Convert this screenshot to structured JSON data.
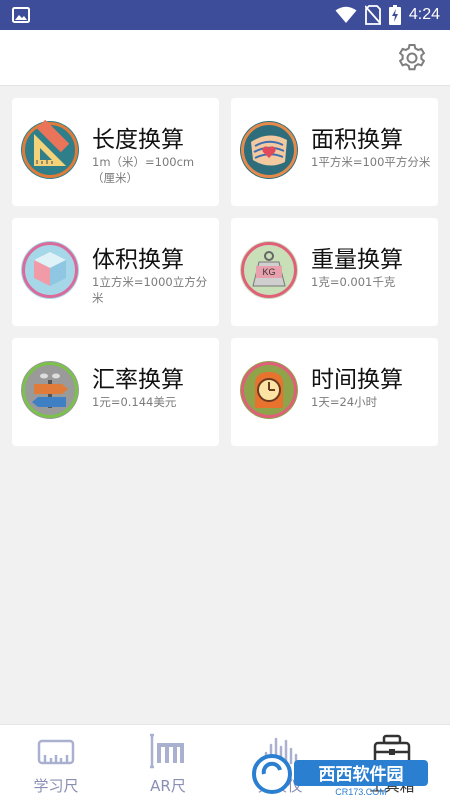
{
  "status_bar": {
    "time": "4:24"
  },
  "colors": {
    "status_bar": "#3d4d9a",
    "nav_inactive": "#8a8fb3",
    "card_bg": "#ffffff",
    "page_bg": "#f1f1f1"
  },
  "header": {
    "settings_icon": "gear-icon"
  },
  "cards": [
    {
      "title": "长度换算",
      "subtitle": "1m（米）=100cm（厘米）",
      "icon": "ruler-triangle-icon"
    },
    {
      "title": "面积换算",
      "subtitle": "1平方米=100平方分米",
      "icon": "map-heart-icon"
    },
    {
      "title": "体积换算",
      "subtitle": "1立方米=1000立方分米",
      "icon": "cube-icon"
    },
    {
      "title": "重量换算",
      "subtitle": "1克=0.001千克",
      "icon": "kg-weight-icon"
    },
    {
      "title": "汇率换算",
      "subtitle": "1元=0.144美元",
      "icon": "exchange-signpost-icon"
    },
    {
      "title": "时间换算",
      "subtitle": "1天=24小时",
      "icon": "clock-icon"
    }
  ],
  "bottom_nav": [
    {
      "label": "学习尺",
      "icon": "ruler-icon"
    },
    {
      "label": "AR尺",
      "icon": "ar-ruler-icon"
    },
    {
      "label": "分贝仪",
      "icon": "sound-bars-icon"
    },
    {
      "label": "工具箱",
      "icon": "toolbox-icon"
    }
  ],
  "watermark": {
    "brand_cn": "西西软件园",
    "brand_url": "CR173.COM"
  }
}
